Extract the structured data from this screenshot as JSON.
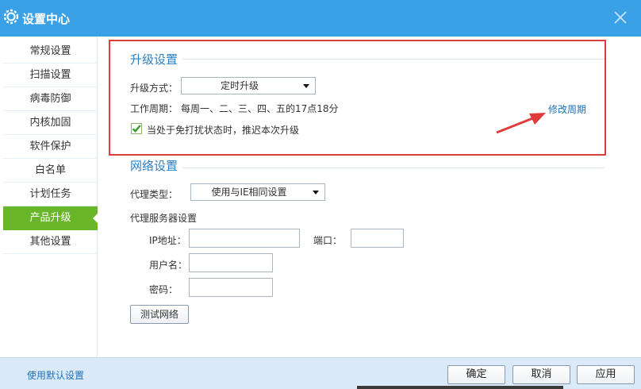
{
  "window": {
    "title": "设置中心"
  },
  "sidebar": {
    "items": [
      {
        "label": "常规设置"
      },
      {
        "label": "扫描设置"
      },
      {
        "label": "病毒防御"
      },
      {
        "label": "内核加固"
      },
      {
        "label": "软件保护"
      },
      {
        "label": "白名单"
      },
      {
        "label": "计划任务"
      },
      {
        "label": "产品升级",
        "active": true
      },
      {
        "label": "其他设置"
      }
    ]
  },
  "upgrade": {
    "title": "升级设置",
    "mode_label": "升级方式：",
    "mode_value": "定时升级",
    "period_label": "工作周期：",
    "period_value": "每周一、二、三、四、五的17点18分",
    "modify_link": "修改周期",
    "postpone_label": "当处于免打扰状态时，推迟本次升级",
    "postpone_checked": true
  },
  "network": {
    "title": "网络设置",
    "proxy_type_label": "代理类型：",
    "proxy_type_value": "使用与IE相同设置",
    "proxy_server_label": "代理服务器设置",
    "ip_label": "IP地址：",
    "port_label": "端口：",
    "username_label": "用户名：",
    "password_label": "密码：",
    "test_button": "测试网络"
  },
  "footer": {
    "default_link": "使用默认设置",
    "ok": "确定",
    "cancel": "取消",
    "apply": "应用"
  },
  "colors": {
    "titlebar": "#3aa1e6",
    "active_nav": "#6ab62a",
    "annotation": "#e03c3c"
  }
}
